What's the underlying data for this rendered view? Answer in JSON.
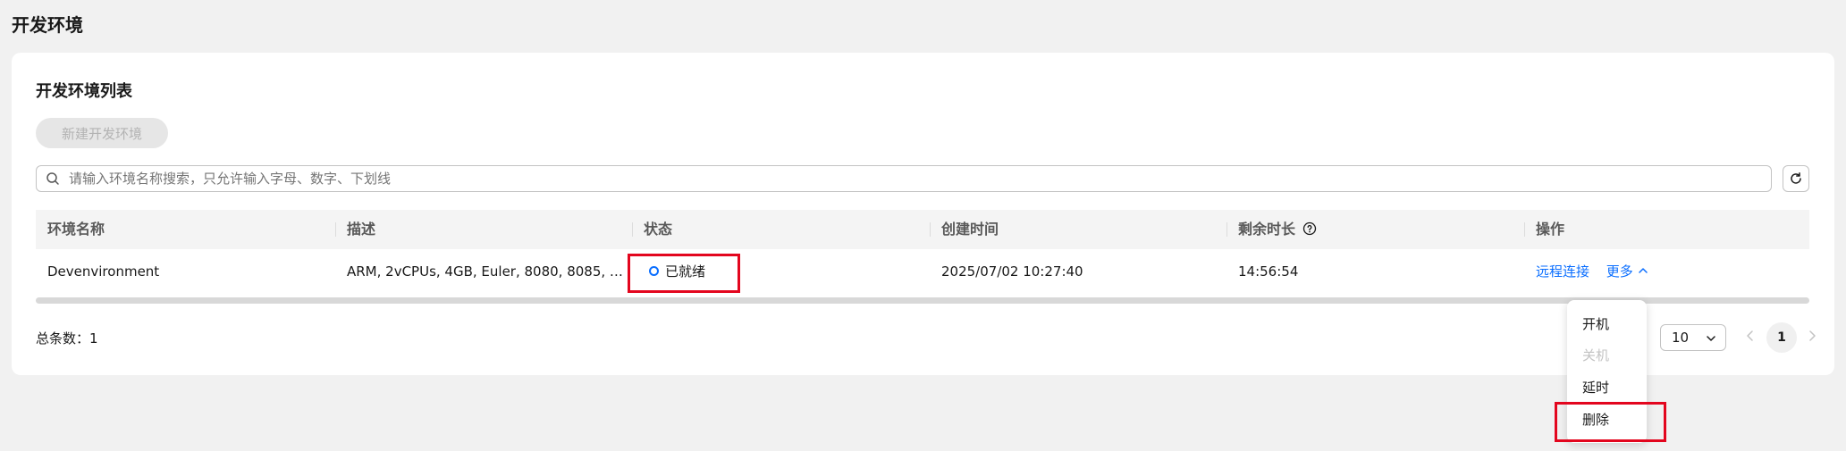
{
  "page": {
    "title": "开发环境"
  },
  "card": {
    "title": "开发环境列表",
    "create_button": "新建开发环境"
  },
  "search": {
    "placeholder": "请输入环境名称搜索，只允许输入字母、数字、下划线"
  },
  "table": {
    "columns": [
      "环境名称",
      "描述",
      "状态",
      "创建时间",
      "剩余时长",
      "操作"
    ],
    "rows": [
      {
        "name": "Devenvironment",
        "description": "ARM, 2vCPUs, 4GB, Euler, 8080, 8085, …",
        "status": "已就绪",
        "created": "2025/07/02 10:27:40",
        "remaining": "14:56:54",
        "action_remote": "远程连接",
        "action_more": "更多"
      }
    ]
  },
  "footer": {
    "total": "总条数：1",
    "page_size": "10",
    "current_page": "1"
  },
  "more_menu": {
    "items": [
      {
        "label": "开机",
        "disabled": false
      },
      {
        "label": "关机",
        "disabled": true
      },
      {
        "label": "延时",
        "disabled": false
      },
      {
        "label": "删除",
        "disabled": false
      }
    ]
  },
  "colors": {
    "accent": "#0a6eff",
    "highlight": "#e3061e"
  },
  "icons": [
    "search-icon",
    "refresh-icon",
    "help-circle-icon",
    "chevron-up-icon",
    "chevron-down-icon",
    "chevron-left-icon",
    "chevron-right-icon",
    "status-ring-icon"
  ]
}
